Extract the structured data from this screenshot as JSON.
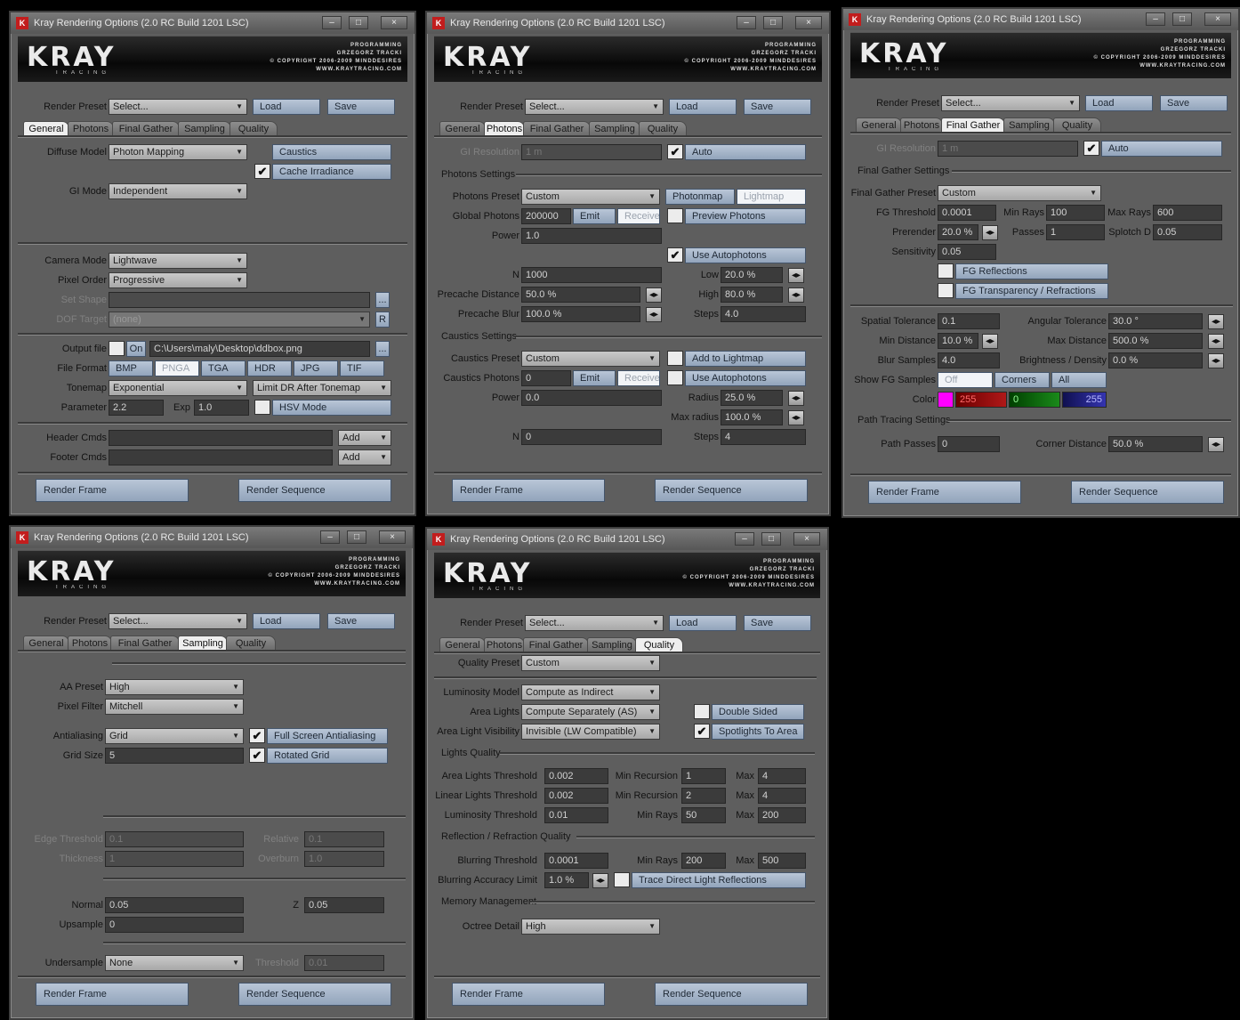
{
  "window": {
    "title": "Kray Rendering Options (2.0 RC Build 1201 LSC)",
    "min_glyph": "–",
    "max_glyph": "□",
    "close_glyph": "×",
    "app_icon": "K"
  },
  "banner": {
    "logo": "KRAY",
    "logo_sub": "TRACING",
    "copyright": "PROGRAMMING\nGRZEGORZ TRACKI\n© COPYRIGHT 2006-2009 MINDDESIRES\nWWW.KRAYTRACING.COM"
  },
  "top": {
    "render_preset_label": "Render Preset",
    "render_preset_value": "Select...",
    "load_label": "Load",
    "save_label": "Save"
  },
  "tabs": [
    "General",
    "Photons",
    "Final Gather",
    "Sampling",
    "Quality"
  ],
  "footer": {
    "render_frame": "Render Frame",
    "render_sequence": "Render Sequence"
  },
  "symbols": {
    "check": "✔",
    "spin": "◂▸",
    "dots": "..."
  },
  "general": {
    "diffuse_model_label": "Diffuse Model",
    "diffuse_model_value": "Photon Mapping",
    "caustics_label": "Caustics",
    "cache_irradiance_label": "Cache Irradiance",
    "gi_mode_label": "GI Mode",
    "gi_mode_value": "Independent",
    "camera_mode_label": "Camera Mode",
    "camera_mode_value": "Lightwave",
    "pixel_order_label": "Pixel Order",
    "pixel_order_value": "Progressive",
    "set_shape_label": "Set Shape",
    "dof_target_label": "DOF Target",
    "dof_target_value": "(none)",
    "dof_button": "R",
    "output_file_label": "Output file",
    "output_on_label": "On",
    "output_path": "C:\\Users\\maly\\Desktop\\ddbox.png",
    "file_format_label": "File Format",
    "formats": [
      "BMP",
      "PNGA",
      "TGA",
      "HDR",
      "JPG",
      "TIF"
    ],
    "tonemap_label": "Tonemap",
    "tonemap_value": "Exponential",
    "limit_dr_value": "Limit DR After Tonemap",
    "parameter_label": "Parameter",
    "parameter_value": "2.2",
    "exp_label": "Exp",
    "exp_value": "1.0",
    "hsv_mode_label": "HSV Mode",
    "header_cmds_label": "Header Cmds",
    "footer_cmds_label": "Footer Cmds",
    "add_label": "Add"
  },
  "photons": {
    "gi_resolution_label": "GI Resolution",
    "gi_resolution_value": "1 m",
    "auto_label": "Auto",
    "photons_settings_label": "Photons Settings",
    "photons_preset_label": "Photons Preset",
    "photons_preset_value": "Custom",
    "photonmap_label": "Photonmap",
    "lightmap_label": "Lightmap",
    "global_photons_label": "Global Photons",
    "global_photons_value": "200000",
    "emit_label": "Emit",
    "receive_label": "Receive",
    "preview_photons_label": "Preview Photons",
    "power_label": "Power",
    "power_value": "1.0",
    "use_autophotons_label": "Use Autophotons",
    "n_label": "N",
    "n_value": "1000",
    "low_label": "Low",
    "low_value": "20.0 %",
    "precache_distance_label": "Precache Distance",
    "precache_distance_value": "50.0 %",
    "high_label": "High",
    "high_value": "80.0 %",
    "precache_blur_label": "Precache Blur",
    "precache_blur_value": "100.0 %",
    "steps_label": "Steps",
    "steps_value": "4.0",
    "caustics_settings_label": "Caustics Settings",
    "caustics_preset_label": "Caustics Preset",
    "caustics_preset_value": "Custom",
    "add_to_lightmap_label": "Add to Lightmap",
    "caustics_photons_label": "Caustics Photons",
    "caustics_photons_value": "0",
    "use_autophotons2_label": "Use Autophotons",
    "power2_value": "0.0",
    "radius_label": "Radius",
    "radius_value": "25.0 %",
    "max_radius_label": "Max radius",
    "max_radius_value": "100.0 %",
    "n2_value": "0",
    "steps2_value": "4"
  },
  "final_gather": {
    "gi_resolution_value": "1 m",
    "fg_settings_label": "Final Gather Settings",
    "fg_preset_label": "Final Gather Preset",
    "fg_preset_value": "Custom",
    "fg_threshold_label": "FG Threshold",
    "fg_threshold_value": "0.0001",
    "min_rays_label": "Min Rays",
    "min_rays_value": "100",
    "max_rays_label": "Max Rays",
    "max_rays_value": "600",
    "prerender_label": "Prerender",
    "prerender_value": "20.0 %",
    "passes_label": "Passes",
    "passes_value": "1",
    "splotch_label": "Splotch D",
    "splotch_value": "0.05",
    "sensitivity_label": "Sensitivity",
    "sensitivity_value": "0.05",
    "fg_reflections_label": "FG Reflections",
    "fg_transparency_label": "FG Transparency / Refractions",
    "spatial_tolerance_label": "Spatial Tolerance",
    "spatial_tolerance_value": "0.1",
    "angular_tolerance_label": "Angular Tolerance",
    "angular_tolerance_value": "30.0 °",
    "min_distance_label": "Min Distance",
    "min_distance_value": "10.0 %",
    "max_distance_label": "Max Distance",
    "max_distance_value": "500.0 %",
    "blur_samples_label": "Blur Samples",
    "blur_samples_value": "4.0",
    "brightness_label": "Brightness / Density",
    "brightness_value": "0.0 %",
    "show_fg_label": "Show FG Samples",
    "show_fg_off": "Off",
    "show_fg_corners": "Corners",
    "show_fg_all": "All",
    "color_label": "Color",
    "color_r": "255",
    "color_g": "0",
    "color_b": "255",
    "path_tracing_label": "Path Tracing Settings",
    "path_passes_label": "Path Passes",
    "path_passes_value": "0",
    "corner_distance_label": "Corner Distance",
    "corner_distance_value": "50.0 %"
  },
  "sampling": {
    "aa_preset_label": "AA Preset",
    "aa_preset_value": "High",
    "pixel_filter_label": "Pixel Filter",
    "pixel_filter_value": "Mitchell",
    "antialiasing_label": "Antialiasing",
    "antialiasing_value": "Grid",
    "full_screen_aa_label": "Full Screen Antialiasing",
    "grid_size_label": "Grid Size",
    "grid_size_value": "5",
    "rotated_grid_label": "Rotated Grid",
    "edge_threshold_label": "Edge Threshold",
    "edge_threshold_value": "0.1",
    "relative_label": "Relative",
    "relative_value": "0.1",
    "thickness_label": "Thickness",
    "thickness_value": "1",
    "overburn_label": "Overburn",
    "overburn_value": "1.0",
    "normal_label": "Normal",
    "normal_value": "0.05",
    "z_label": "Z",
    "z_value": "0.05",
    "upsample_label": "Upsample",
    "upsample_value": "0",
    "undersample_label": "Undersample",
    "undersample_value": "None",
    "threshold_label": "Threshold",
    "threshold_value": "0.01"
  },
  "quality": {
    "quality_preset_label": "Quality Preset",
    "quality_preset_value": "Custom",
    "luminosity_model_label": "Luminosity Model",
    "luminosity_model_value": "Compute as Indirect",
    "area_lights_label": "Area Lights",
    "area_lights_value": "Compute Separately (AS)",
    "double_sided_label": "Double Sided",
    "area_light_visibility_label": "Area Light Visibility",
    "area_light_visibility_value": "Invisible (LW Compatible)",
    "spotlights_label": "Spotlights To Area",
    "lights_quality_label": "Lights Quality",
    "area_thr_label": "Area Lights Threshold",
    "area_thr_value": "0.002",
    "linear_thr_label": "Linear Lights Threshold",
    "linear_thr_value": "0.002",
    "lum_thr_label": "Luminosity Threshold",
    "lum_thr_value": "0.01",
    "min_recursion_label": "Min Recursion",
    "min_rec1_value": "1",
    "min_rec2_value": "2",
    "min_rays_label": "Min Rays",
    "min_rays1_value": "50",
    "max_label": "Max",
    "max1_value": "4",
    "max2_value": "4",
    "max3_value": "200",
    "refl_quality_label": "Reflection / Refraction Quality",
    "blurring_thr_label": "Blurring Threshold",
    "blurring_thr_value": "0.0001",
    "min_rays2_value": "200",
    "max4_value": "500",
    "blurring_acc_label": "Blurring Accuracy Limit",
    "blurring_acc_value": "1.0 %",
    "trace_direct_label": "Trace Direct Light Reflections",
    "memory_label": "Memory Management",
    "octree_label": "Octree Detail",
    "octree_value": "High"
  }
}
